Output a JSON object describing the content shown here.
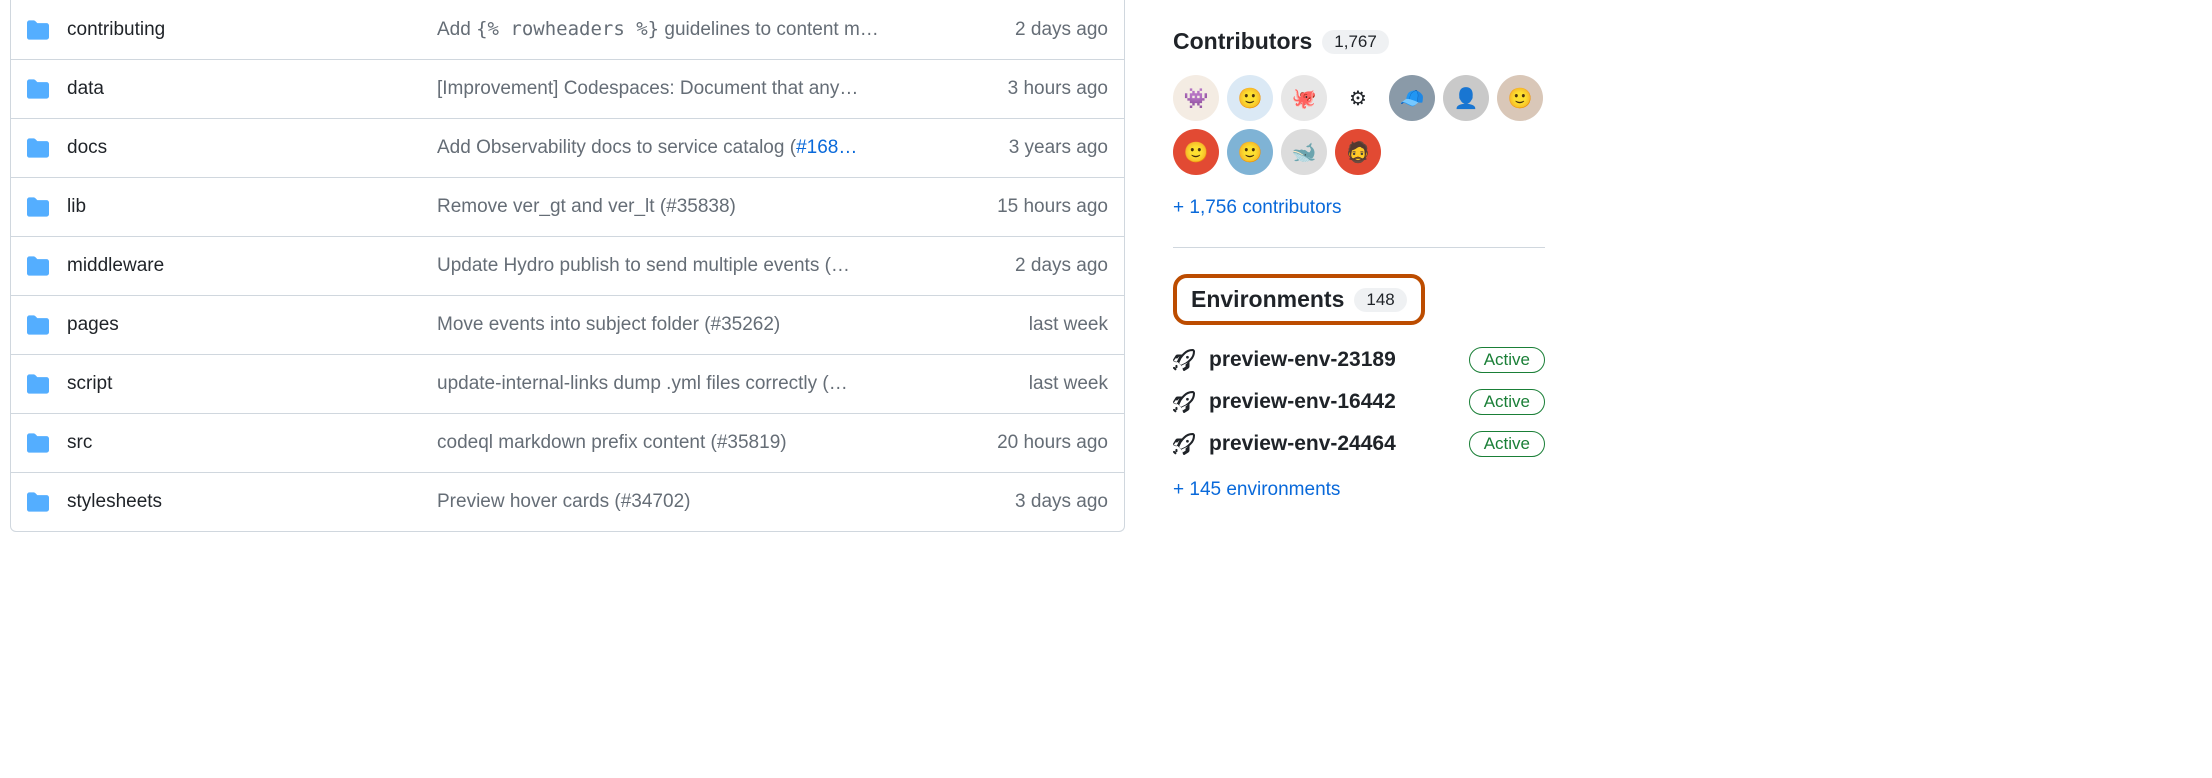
{
  "files": [
    {
      "name": "contributing",
      "commit_prefix": "Add ",
      "commit_code": "{% rowheaders %}",
      "commit_suffix": " guidelines to content m…",
      "time": "2 days ago"
    },
    {
      "name": "data",
      "commit_plain": "[Improvement] Codespaces: Document that any…",
      "time": "3 hours ago"
    },
    {
      "name": "docs",
      "commit_prefix": "Add Observability docs to service catalog (",
      "commit_link": "#168…",
      "time": "3 years ago"
    },
    {
      "name": "lib",
      "commit_plain": "Remove ver_gt and ver_lt (#35838)",
      "time": "15 hours ago"
    },
    {
      "name": "middleware",
      "commit_plain": "Update Hydro publish to send multiple events (…",
      "time": "2 days ago"
    },
    {
      "name": "pages",
      "commit_plain": "Move events into subject folder (#35262)",
      "time": "last week"
    },
    {
      "name": "script",
      "commit_plain": "update-internal-links dump .yml files correctly (…",
      "time": "last week"
    },
    {
      "name": "src",
      "commit_plain": "codeql markdown prefix content (#35819)",
      "time": "20 hours ago"
    },
    {
      "name": "stylesheets",
      "commit_plain": "Preview hover cards (#34702)",
      "time": "3 days ago"
    }
  ],
  "sidebar": {
    "contributors": {
      "title": "Contributors",
      "count": "1,767",
      "avatars": [
        {
          "bg": "#f4ece3",
          "glyph": "👾"
        },
        {
          "bg": "#dbe9f5",
          "glyph": "🙂"
        },
        {
          "bg": "#e7e7e7",
          "glyph": "🐙"
        },
        {
          "bg": "#ffffff",
          "glyph": "⚙"
        },
        {
          "bg": "#8a9aa8",
          "glyph": "🧢"
        },
        {
          "bg": "#c9c9c9",
          "glyph": "👤"
        },
        {
          "bg": "#d9c7b8",
          "glyph": "🙂"
        },
        {
          "bg": "#e24a33",
          "glyph": "🙂"
        },
        {
          "bg": "#7fb3d5",
          "glyph": "🙂"
        },
        {
          "bg": "#dcdcdc",
          "glyph": "🐋"
        },
        {
          "bg": "#e24a33",
          "glyph": "🧔"
        }
      ],
      "more": "+ 1,756 contributors"
    },
    "environments": {
      "title": "Environments",
      "count": "148",
      "items": [
        {
          "name": "preview-env-23189",
          "status": "Active"
        },
        {
          "name": "preview-env-16442",
          "status": "Active"
        },
        {
          "name": "preview-env-24464",
          "status": "Active"
        }
      ],
      "more": "+ 145 environments"
    }
  }
}
